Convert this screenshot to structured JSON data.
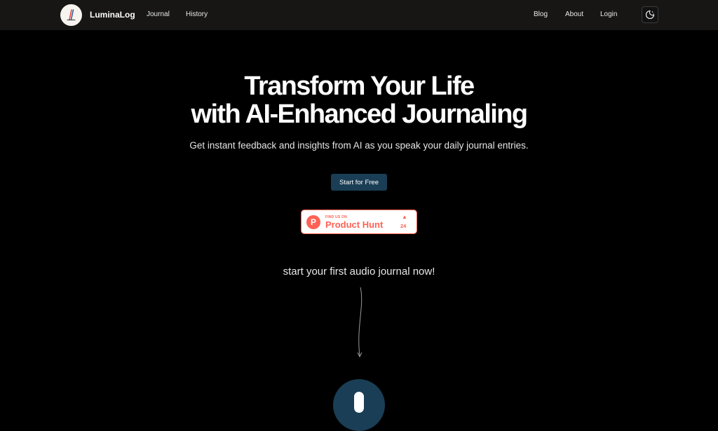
{
  "header": {
    "brand": "LuminaLog",
    "nav_left": [
      "Journal",
      "History"
    ],
    "nav_right": [
      "Blog",
      "About",
      "Login"
    ],
    "theme_toggle_icon": "moon-sun-icon"
  },
  "hero": {
    "title_line1": "Transform Your Life",
    "title_line2": "with AI-Enhanced Journaling",
    "subtitle": "Get instant feedback and insights from AI as you speak your daily journal entries.",
    "cta_label": "Start for Free"
  },
  "product_hunt": {
    "find_text": "FIND US ON",
    "name": "Product Hunt",
    "logo_letter": "P",
    "upvotes": "24"
  },
  "audio": {
    "prompt": "start your first audio journal now!",
    "mic_icon": "microphone-icon"
  },
  "colors": {
    "background": "#000000",
    "navbar": "#171615",
    "accent": "#1a3e55",
    "product_hunt": "#ff6154"
  }
}
